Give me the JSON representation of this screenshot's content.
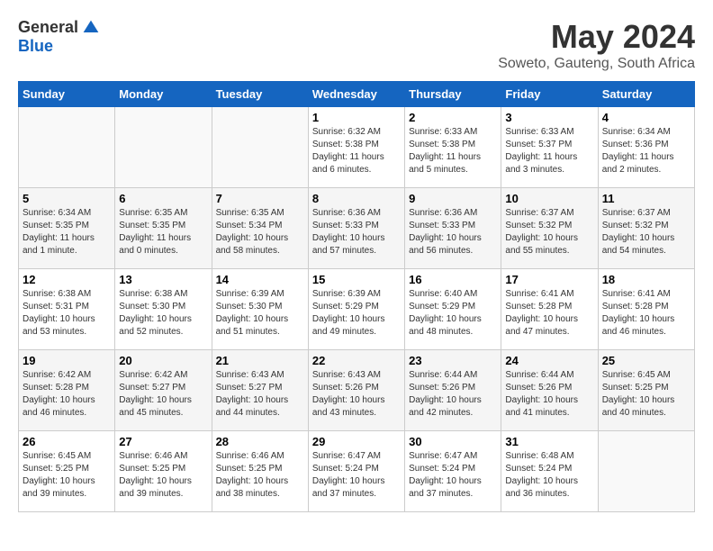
{
  "logo": {
    "general": "General",
    "blue": "Blue"
  },
  "title": "May 2024",
  "location": "Soweto, Gauteng, South Africa",
  "days_header": [
    "Sunday",
    "Monday",
    "Tuesday",
    "Wednesday",
    "Thursday",
    "Friday",
    "Saturday"
  ],
  "weeks": [
    [
      {
        "day": "",
        "info": ""
      },
      {
        "day": "",
        "info": ""
      },
      {
        "day": "",
        "info": ""
      },
      {
        "day": "1",
        "info": "Sunrise: 6:32 AM\nSunset: 5:38 PM\nDaylight: 11 hours and 6 minutes."
      },
      {
        "day": "2",
        "info": "Sunrise: 6:33 AM\nSunset: 5:38 PM\nDaylight: 11 hours and 5 minutes."
      },
      {
        "day": "3",
        "info": "Sunrise: 6:33 AM\nSunset: 5:37 PM\nDaylight: 11 hours and 3 minutes."
      },
      {
        "day": "4",
        "info": "Sunrise: 6:34 AM\nSunset: 5:36 PM\nDaylight: 11 hours and 2 minutes."
      }
    ],
    [
      {
        "day": "5",
        "info": "Sunrise: 6:34 AM\nSunset: 5:35 PM\nDaylight: 11 hours and 1 minute."
      },
      {
        "day": "6",
        "info": "Sunrise: 6:35 AM\nSunset: 5:35 PM\nDaylight: 11 hours and 0 minutes."
      },
      {
        "day": "7",
        "info": "Sunrise: 6:35 AM\nSunset: 5:34 PM\nDaylight: 10 hours and 58 minutes."
      },
      {
        "day": "8",
        "info": "Sunrise: 6:36 AM\nSunset: 5:33 PM\nDaylight: 10 hours and 57 minutes."
      },
      {
        "day": "9",
        "info": "Sunrise: 6:36 AM\nSunset: 5:33 PM\nDaylight: 10 hours and 56 minutes."
      },
      {
        "day": "10",
        "info": "Sunrise: 6:37 AM\nSunset: 5:32 PM\nDaylight: 10 hours and 55 minutes."
      },
      {
        "day": "11",
        "info": "Sunrise: 6:37 AM\nSunset: 5:32 PM\nDaylight: 10 hours and 54 minutes."
      }
    ],
    [
      {
        "day": "12",
        "info": "Sunrise: 6:38 AM\nSunset: 5:31 PM\nDaylight: 10 hours and 53 minutes."
      },
      {
        "day": "13",
        "info": "Sunrise: 6:38 AM\nSunset: 5:30 PM\nDaylight: 10 hours and 52 minutes."
      },
      {
        "day": "14",
        "info": "Sunrise: 6:39 AM\nSunset: 5:30 PM\nDaylight: 10 hours and 51 minutes."
      },
      {
        "day": "15",
        "info": "Sunrise: 6:39 AM\nSunset: 5:29 PM\nDaylight: 10 hours and 49 minutes."
      },
      {
        "day": "16",
        "info": "Sunrise: 6:40 AM\nSunset: 5:29 PM\nDaylight: 10 hours and 48 minutes."
      },
      {
        "day": "17",
        "info": "Sunrise: 6:41 AM\nSunset: 5:28 PM\nDaylight: 10 hours and 47 minutes."
      },
      {
        "day": "18",
        "info": "Sunrise: 6:41 AM\nSunset: 5:28 PM\nDaylight: 10 hours and 46 minutes."
      }
    ],
    [
      {
        "day": "19",
        "info": "Sunrise: 6:42 AM\nSunset: 5:28 PM\nDaylight: 10 hours and 46 minutes."
      },
      {
        "day": "20",
        "info": "Sunrise: 6:42 AM\nSunset: 5:27 PM\nDaylight: 10 hours and 45 minutes."
      },
      {
        "day": "21",
        "info": "Sunrise: 6:43 AM\nSunset: 5:27 PM\nDaylight: 10 hours and 44 minutes."
      },
      {
        "day": "22",
        "info": "Sunrise: 6:43 AM\nSunset: 5:26 PM\nDaylight: 10 hours and 43 minutes."
      },
      {
        "day": "23",
        "info": "Sunrise: 6:44 AM\nSunset: 5:26 PM\nDaylight: 10 hours and 42 minutes."
      },
      {
        "day": "24",
        "info": "Sunrise: 6:44 AM\nSunset: 5:26 PM\nDaylight: 10 hours and 41 minutes."
      },
      {
        "day": "25",
        "info": "Sunrise: 6:45 AM\nSunset: 5:25 PM\nDaylight: 10 hours and 40 minutes."
      }
    ],
    [
      {
        "day": "26",
        "info": "Sunrise: 6:45 AM\nSunset: 5:25 PM\nDaylight: 10 hours and 39 minutes."
      },
      {
        "day": "27",
        "info": "Sunrise: 6:46 AM\nSunset: 5:25 PM\nDaylight: 10 hours and 39 minutes."
      },
      {
        "day": "28",
        "info": "Sunrise: 6:46 AM\nSunset: 5:25 PM\nDaylight: 10 hours and 38 minutes."
      },
      {
        "day": "29",
        "info": "Sunrise: 6:47 AM\nSunset: 5:24 PM\nDaylight: 10 hours and 37 minutes."
      },
      {
        "day": "30",
        "info": "Sunrise: 6:47 AM\nSunset: 5:24 PM\nDaylight: 10 hours and 37 minutes."
      },
      {
        "day": "31",
        "info": "Sunrise: 6:48 AM\nSunset: 5:24 PM\nDaylight: 10 hours and 36 minutes."
      },
      {
        "day": "",
        "info": ""
      }
    ]
  ]
}
